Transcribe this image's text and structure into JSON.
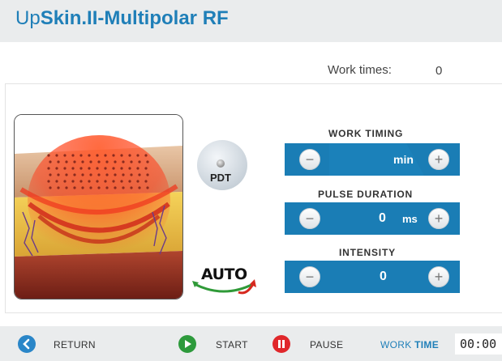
{
  "header": {
    "title_prefix": "Up",
    "title_bold": "Skin.II-Multipolar RF"
  },
  "work_times": {
    "label": "Work times",
    "separator": ":",
    "value": "0"
  },
  "mode_buttons": {
    "pdt_label": "PDT",
    "auto_label": "AUTO"
  },
  "controls": {
    "work_timing": {
      "label": "WORK TIMING",
      "value": "",
      "unit": "min"
    },
    "pulse_duration": {
      "label": "PULSE DURATION",
      "value": "0",
      "unit": "ms"
    },
    "intensity": {
      "label": "INTENSITY",
      "value": "0",
      "unit": ""
    },
    "minus_symbol": "−",
    "plus_symbol": "+"
  },
  "footer": {
    "return_label": "RETURN",
    "start_label": "START",
    "pause_label": "PAUSE",
    "work_time_label_1": "WORK",
    "work_time_label_2": "TIME",
    "work_time_value": "00:00"
  },
  "colors": {
    "accent": "#1f7fb8",
    "control_bar": "#1a7db5",
    "start_green": "#2d9a3c",
    "pause_red": "#e0272b",
    "return_blue": "#2a86c8"
  },
  "icons": {
    "return": "chevron-left-icon",
    "start": "play-icon",
    "pause": "pause-icon",
    "minus": "minus-icon",
    "plus": "plus-icon"
  }
}
